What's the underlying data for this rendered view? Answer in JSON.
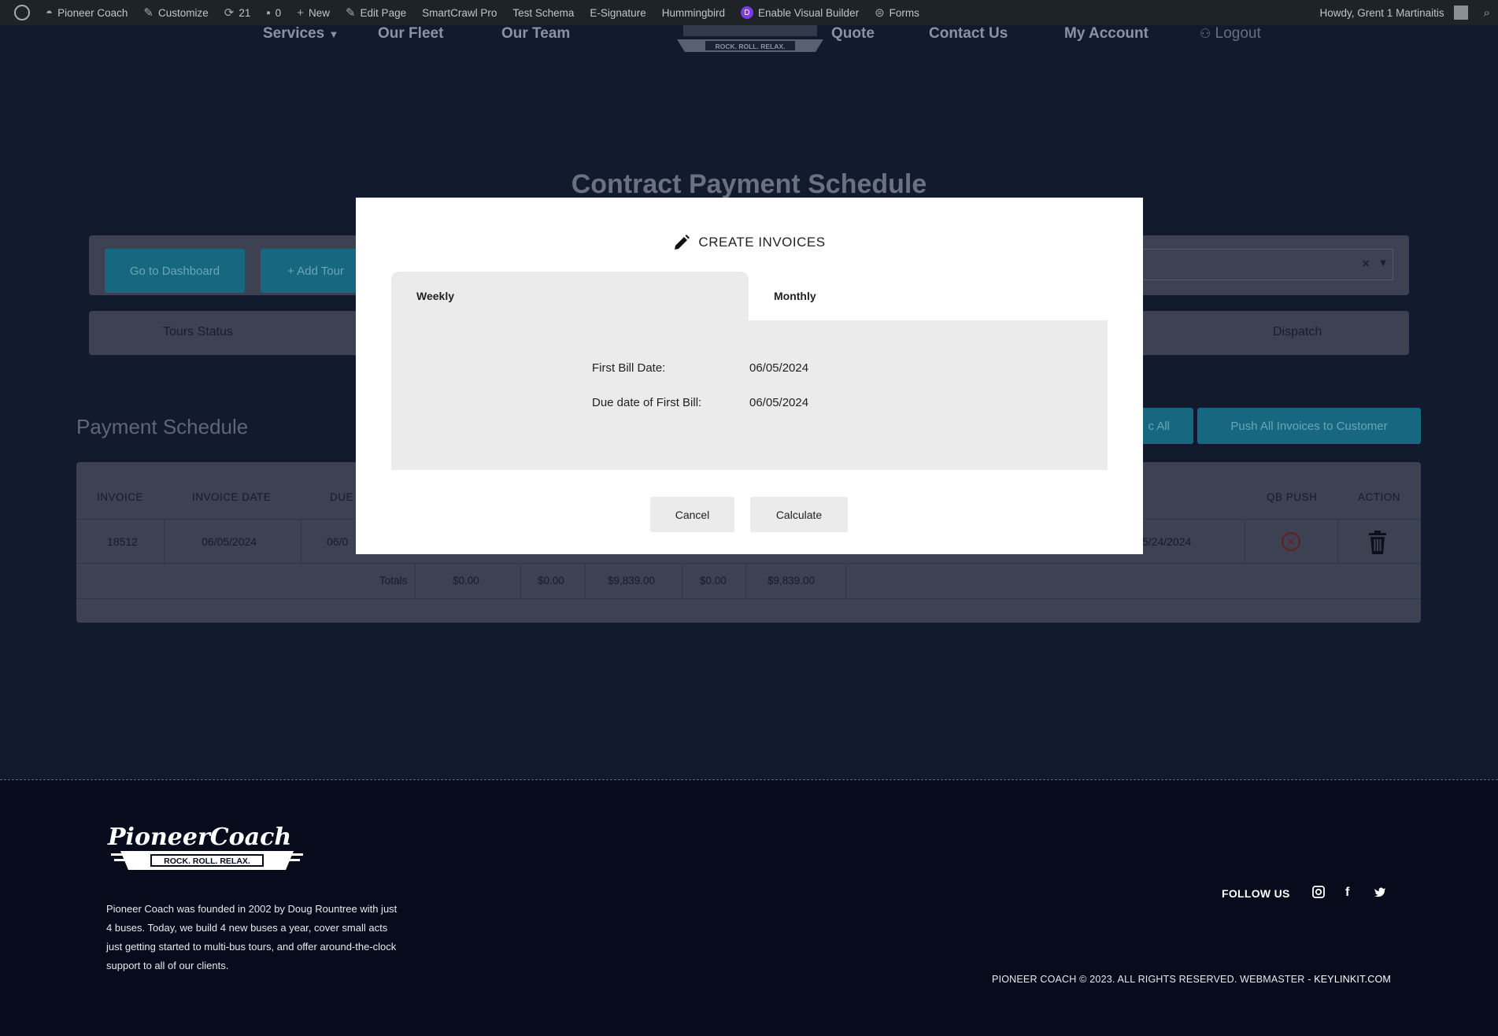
{
  "adminbar": {
    "site": "Pioneer Coach",
    "customize": "Customize",
    "updates": "21",
    "comments": "0",
    "new": "New",
    "edit_page": "Edit Page",
    "smartcrawl": "SmartCrawl Pro",
    "test_schema": "Test Schema",
    "esignature": "E-Signature",
    "hummingbird": "Hummingbird",
    "visual_builder": "Enable Visual Builder",
    "forms": "Forms",
    "howdy": "Howdy, Grent 1 Martinaitis"
  },
  "nav": {
    "services": "Services",
    "fleet": "Our Fleet",
    "team": "Our Team",
    "quote": "Quote",
    "contact": "Contact Us",
    "account": "My Account",
    "logout": "Logout",
    "logo_tagline": "ROCK. ROLL. RELAX."
  },
  "page": {
    "title": "Contract Payment Schedule",
    "go_dashboard": "Go to Dashboard",
    "add_tour": "+ Add Tour",
    "tabs": {
      "tours_status": "Tours Status",
      "dispatch": "Dispatch"
    },
    "section_title": "Payment Schedule",
    "sync_all_partial": "c All",
    "push_all": "Push All Invoices to Customer"
  },
  "table": {
    "headers": {
      "invoice": "INVOICE",
      "invoice_date": "INVOICE DATE",
      "due": "DUE",
      "qb_push": "QB PUSH",
      "action": "ACTION"
    },
    "row": {
      "invoice": "18512",
      "invoice_date": "06/05/2024",
      "due_partial": "06/0",
      "end_partial": "5/24/2024"
    },
    "totals": {
      "label": "Totals",
      "v1": "$0.00",
      "v2": "$0.00",
      "v3": "$9,839.00",
      "v4": "$0.00",
      "v5": "$9,839.00"
    }
  },
  "modal": {
    "title": "CREATE INVOICES",
    "tab_weekly": "Weekly",
    "tab_monthly": "Monthly",
    "first_bill_label": "First Bill Date:",
    "first_bill_value": "06/05/2024",
    "due_first_label": "Due date of First Bill:",
    "due_first_value": "06/05/2024",
    "cancel": "Cancel",
    "calculate": "Calculate"
  },
  "footer": {
    "logo_text": "PioneerCoach",
    "logo_tagline": "ROCK. ROLL. RELAX.",
    "about": "Pioneer Coach was founded in 2002 by Doug Rountree with just 4 buses. Today, we build 4 new buses a year, cover small acts just getting started to multi-bus tours, and offer around-the-clock support to all of our clients.",
    "follow": "FOLLOW US",
    "copyright": "PIONEER COACH © 2023. ALL RIGHTS RESERVED. WEBMASTER - ",
    "webmaster": "KEYLINKIT.COM"
  },
  "colors": {
    "accent": "#16677f",
    "modal_bg": "#ffffff",
    "panel": "#ebebeb",
    "footer_bg": "#070b1c",
    "danger": "#6b1a22"
  },
  "icons": [
    "wordpress-icon",
    "dashboard-icon",
    "pencil-icon",
    "refresh-icon",
    "comment-icon",
    "plus-icon",
    "divi-icon",
    "forms-icon",
    "user-icon",
    "search-icon",
    "chevron-down-icon",
    "close-circle-icon",
    "trash-icon",
    "instagram-icon",
    "facebook-icon",
    "twitter-icon"
  ]
}
